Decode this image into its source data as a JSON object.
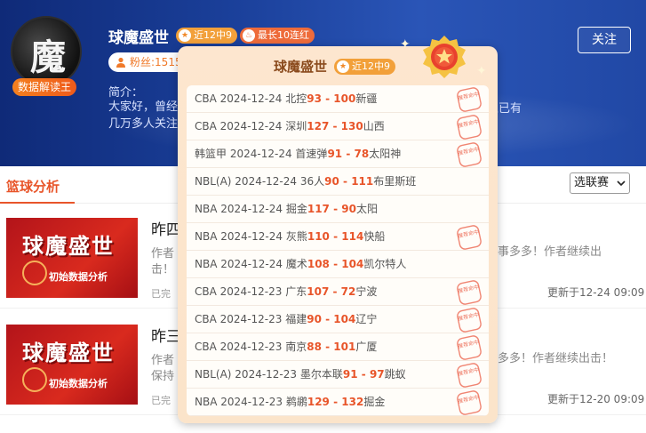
{
  "author": {
    "name": "球魔盛世",
    "avatar_char": "魔",
    "avatar_badge": "数据解读王",
    "tag_recent": "近12中9",
    "tag_streak": "最长10连红",
    "fans": "粉丝:1515",
    "follow": "关注",
    "intro_label": "简介：",
    "intro_text_start": "大家好，曾经",
    "intro_text_end": "几万多人关注",
    "intro_text_tail": "丝已有"
  },
  "section": {
    "title": "篮球分析",
    "league_select": "选联赛"
  },
  "articles": [
    {
      "thumb_title": "球魔盛世",
      "thumb_sub": "初始数据分析",
      "title": "昨四",
      "desc_left": "作者",
      "desc_right_1": "事多多！作者继续出",
      "desc_right_2": "击！",
      "status": "已完",
      "time": "更新于12-24 09:09"
    },
    {
      "thumb_title": "球魔盛世",
      "thumb_sub": "初始数据分析",
      "title": "昨三",
      "desc_left": "作者",
      "desc_left_2": "保持",
      "desc_right_1": "多多！作者继续出击！",
      "status": "已完",
      "time": "更新于12-20 09:09"
    }
  ],
  "popup": {
    "name": "球魔盛世",
    "tag": "近12中9",
    "stamp_text": "推荐命中",
    "records": [
      {
        "league": "CBA",
        "date": "2024-12-24",
        "home": "北控",
        "home_score": "93",
        "sep": " - ",
        "away_score": "100",
        "away": "新疆",
        "hit": true
      },
      {
        "league": "CBA",
        "date": "2024-12-24",
        "home": "深圳",
        "home_score": "127",
        "sep": " - ",
        "away_score": "130",
        "away": "山西",
        "hit": true
      },
      {
        "league": "韩篮甲",
        "date": "2024-12-24",
        "home": "首速弹",
        "home_score": "91",
        "sep": " - ",
        "away_score": "78",
        "away": "太阳神",
        "hit": true
      },
      {
        "league": "NBL(A)",
        "date": "2024-12-24",
        "home": "36人",
        "home_score": "90",
        "sep": " - ",
        "away_score": "111",
        "away": "布里斯班",
        "hit": false
      },
      {
        "league": "NBA",
        "date": "2024-12-24",
        "home": "掘金",
        "home_score": "117",
        "sep": " - ",
        "away_score": "90",
        "away": "太阳",
        "hit": false
      },
      {
        "league": "NBA",
        "date": "2024-12-24",
        "home": "灰熊",
        "home_score": "110",
        "sep": " - ",
        "away_score": "114",
        "away": "快船",
        "hit": true
      },
      {
        "league": "NBA",
        "date": "2024-12-24",
        "home": "魔术",
        "home_score": "108",
        "sep": " - ",
        "away_score": "104",
        "away": "凯尔特人",
        "hit": false
      },
      {
        "league": "CBA",
        "date": "2024-12-23",
        "home": "广东",
        "home_score": "107",
        "sep": " - ",
        "away_score": "72",
        "away": "宁波",
        "hit": true
      },
      {
        "league": "CBA",
        "date": "2024-12-23",
        "home": "福建",
        "home_score": "90",
        "sep": " - ",
        "away_score": "104",
        "away": "辽宁",
        "hit": true
      },
      {
        "league": "CBA",
        "date": "2024-12-23",
        "home": "南京",
        "home_score": "88",
        "sep": " - ",
        "away_score": "101",
        "away": "广厦",
        "hit": true
      },
      {
        "league": "NBL(A)",
        "date": "2024-12-23",
        "home": "墨尔本联",
        "home_score": "91",
        "sep": " - ",
        "away_score": "97",
        "away": "跳蚁",
        "hit": true
      },
      {
        "league": "NBA",
        "date": "2024-12-23",
        "home": "鹈鹕",
        "home_score": "129",
        "sep": " - ",
        "away_score": "132",
        "away": "掘金",
        "hit": true
      }
    ]
  },
  "colors": {
    "accent": "#e8552a",
    "banner": "#1a3f99",
    "stamp": "#e9533a"
  }
}
